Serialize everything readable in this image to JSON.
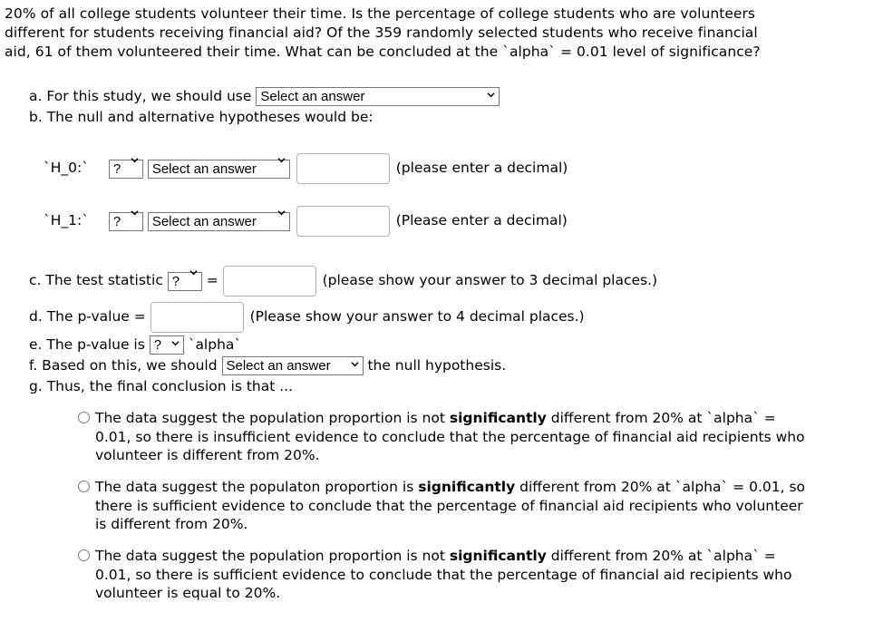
{
  "question": {
    "lines": [
      "20% of all college students volunteer their time. Is the percentage of college students who are volunteers",
      "different for students receiving financial aid? Of the 359 randomly selected students who receive financial",
      "aid, 61 of them volunteered their time. What can be concluded at the `alpha` = 0.01 level of significance?"
    ]
  },
  "part_a": {
    "label": "a. For this study, we should use",
    "select_value": "Select an answer"
  },
  "part_b": {
    "label": "b. The null and alternative hypotheses would be:",
    "h0": {
      "label": "`H_0:`",
      "symbol_select": "?",
      "param_select": "Select an answer",
      "input_value": "",
      "hint": "(please enter a decimal)"
    },
    "h1": {
      "label": "`H_1:`",
      "symbol_select": "?",
      "param_select": "Select an answer",
      "input_value": "",
      "hint": "(Please enter a decimal)"
    }
  },
  "part_c": {
    "label": "c. The test statistic",
    "select_value": "?",
    "equals": "=",
    "input_value": "",
    "hint": "(please show your answer to 3 decimal places.)"
  },
  "part_d": {
    "label": "d. The p-value =",
    "input_value": "",
    "hint": "(Please show your answer to 4 decimal places.)"
  },
  "part_e": {
    "label": "e. The p-value is",
    "select_value": "?",
    "suffix": "`alpha`"
  },
  "part_f": {
    "label": "f. Based on this, we should",
    "select_value": "Select an answer",
    "suffix": "the null hypothesis."
  },
  "part_g": {
    "label": "g. Thus, the final conclusion is that ...",
    "options": [
      {
        "pre": "The data suggest the population proportion is not ",
        "bold": "significantly",
        "post": " different from 20% at `alpha` = 0.01, so there is insufficient evidence to conclude that the percentage of financial aid recipients who volunteer is different from 20%.",
        "selected": false
      },
      {
        "pre": "The data suggest the populaton proportion is ",
        "bold": "significantly",
        "post": " different from 20% at `alpha` = 0.01, so there is sufficient evidence to conclude that the percentage of financial aid recipients who volunteer is different from 20%.",
        "selected": false
      },
      {
        "pre": "The data suggest the population proportion is not ",
        "bold": "significantly",
        "post": " different from 20% at `alpha` = 0.01, so there is sufficient evidence to conclude that the percentage of financial aid recipients who volunteer is equal to 20%.",
        "selected": false
      }
    ]
  }
}
